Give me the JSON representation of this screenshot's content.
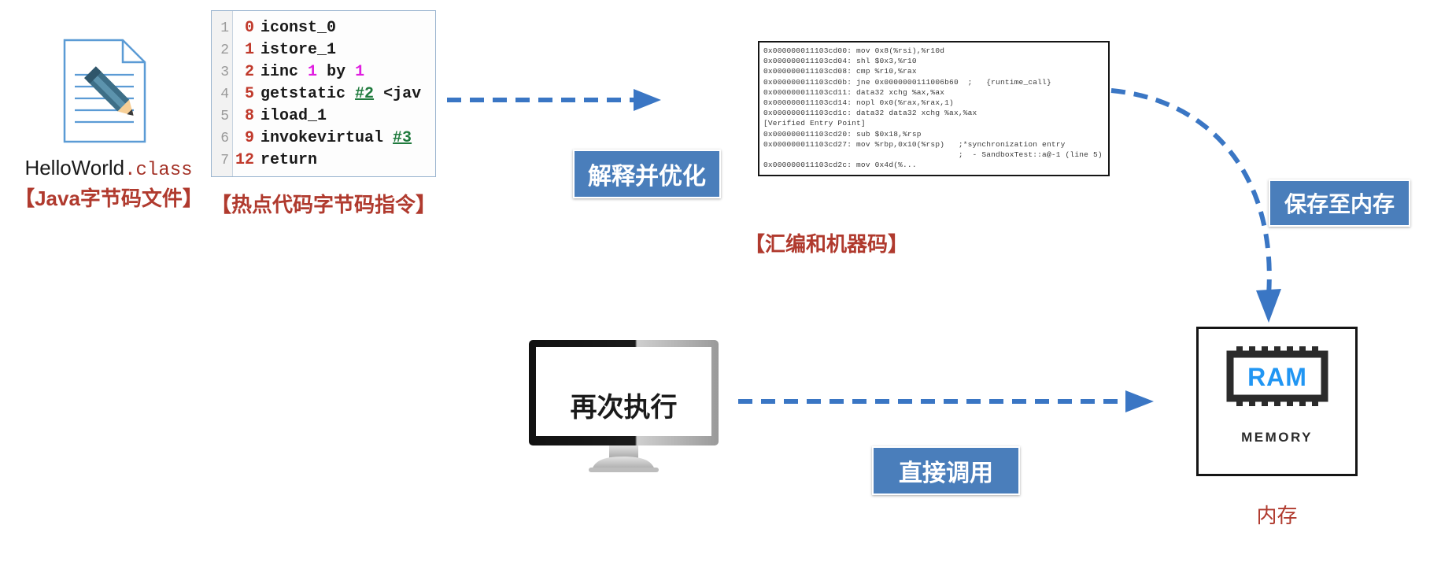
{
  "diagram": {
    "title": "JIT compilation flow",
    "colors": {
      "accent_blue": "#4a7ebb",
      "arrow_blue": "#3a76c4",
      "caption_red": "#b03a2e",
      "bytecode_offset_red": "#c0392b",
      "bytecode_ref_green": "#1f7a3d",
      "bytecode_num_magenta": "#e01ee0",
      "ram_blue": "#2196f3"
    }
  },
  "file": {
    "icon_name": "document-with-pencil-icon",
    "name_base": "HelloWorld",
    "name_ext": ".class",
    "caption": "【Java字节码文件】"
  },
  "bytecode": {
    "caption": "【热点代码字节码指令】",
    "rows": [
      {
        "line": "1",
        "offset": "0",
        "op": "iconst_0",
        "arg": "",
        "arg_type": "none"
      },
      {
        "line": "2",
        "offset": "1",
        "op": "istore_1",
        "arg": "",
        "arg_type": "none"
      },
      {
        "line": "3",
        "offset": "2",
        "op": "iinc",
        "arg": "1 by 1",
        "arg_type": "num"
      },
      {
        "line": "4",
        "offset": "5",
        "op": "getstatic",
        "arg": "#2",
        "arg_type": "ref",
        "trailing": " <jav"
      },
      {
        "line": "5",
        "offset": "8",
        "op": "iload_1",
        "arg": "",
        "arg_type": "none"
      },
      {
        "line": "6",
        "offset": "9",
        "op": "invokevirtual",
        "arg": "#3",
        "arg_type": "ref"
      },
      {
        "line": "7",
        "offset": "12",
        "op": "return",
        "arg": "",
        "arg_type": "none"
      }
    ]
  },
  "assembly": {
    "caption": "【汇编和机器码】",
    "lines": [
      "0x000000011103cd00: mov 0x8(%rsi),%r10d",
      "0x000000011103cd04: shl $0x3,%r10",
      "0x000000011103cd08: cmp %r10,%rax",
      "0x000000011103cd0b: jne 0x0000000111006b60  ;   {runtime_call}",
      "0x000000011103cd11: data32 xchg %ax,%ax",
      "0x000000011103cd14: nopl 0x0(%rax,%rax,1)",
      "0x000000011103cd1c: data32 data32 xchg %ax,%ax",
      "[Verified Entry Point]",
      "0x000000011103cd20: sub $0x18,%rsp",
      "0x000000011103cd27: mov %rbp,0x10(%rsp)   ;*synchronization entry",
      "                                          ;  - SandboxTest::a@-1 (line 5)",
      "0x000000011103cd2c: mov 0x4d(%..."
    ]
  },
  "labels": {
    "interpret_optimize": "解释并优化",
    "save_to_memory": "保存至内存",
    "direct_invoke": "直接调用"
  },
  "monitor": {
    "icon_name": "desktop-monitor-icon",
    "screen_text": "再次执行"
  },
  "memory": {
    "chip_text": "RAM",
    "chip_label": "MEMORY",
    "caption": "内存"
  },
  "arrows": {
    "bytecode_to_asm": "dashed-arrow-right",
    "asm_to_memory": "dashed-curved-arrow-down",
    "monitor_to_memory": "dashed-arrow-right"
  }
}
